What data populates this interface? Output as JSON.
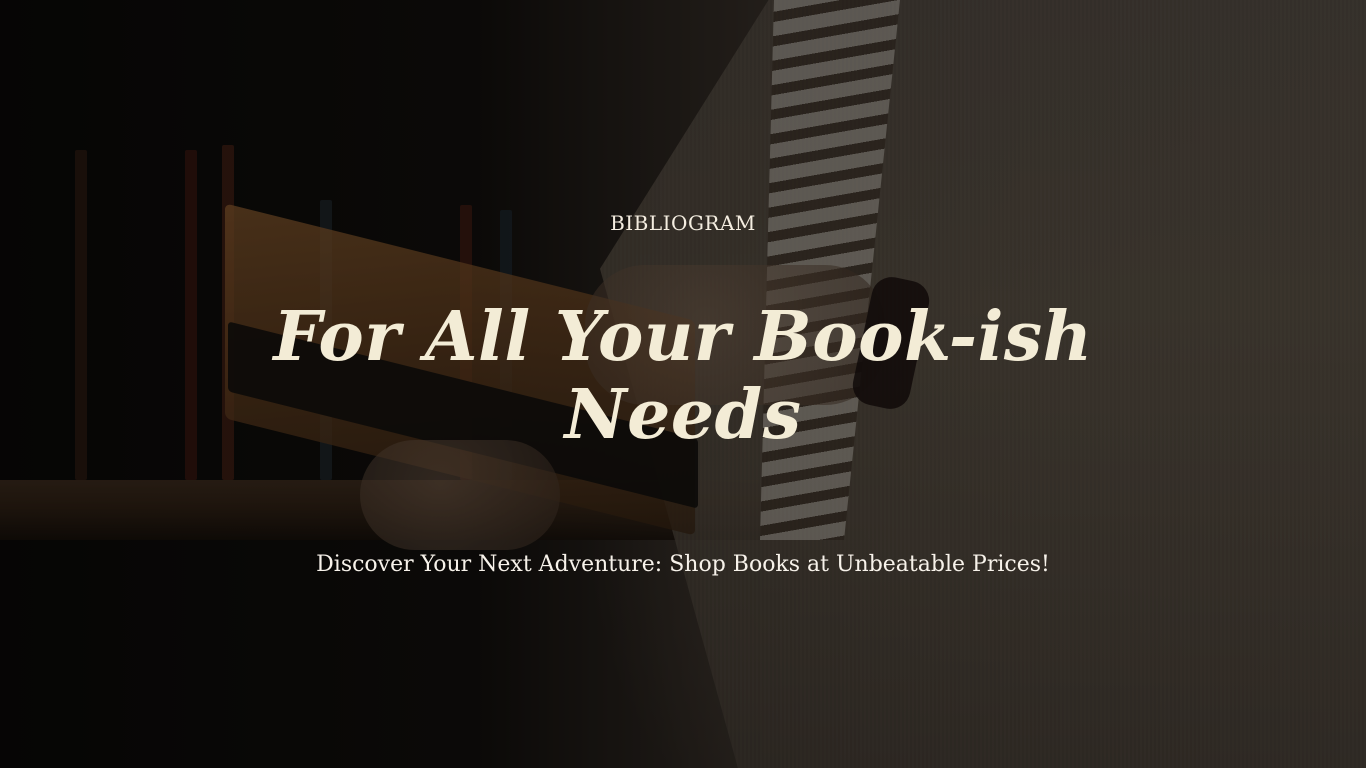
{
  "hero": {
    "brand": "BIBLIOGRAM",
    "headline": "For All Your Book-ish Needs",
    "tagline": "Discover Your Next Adventure: Shop Books at Unbeatable Prices!",
    "background_image": "person-holding-open-book"
  },
  "colors": {
    "headline": "#f3ecd6",
    "text": "#f4ede0",
    "overlay": "#000000"
  }
}
